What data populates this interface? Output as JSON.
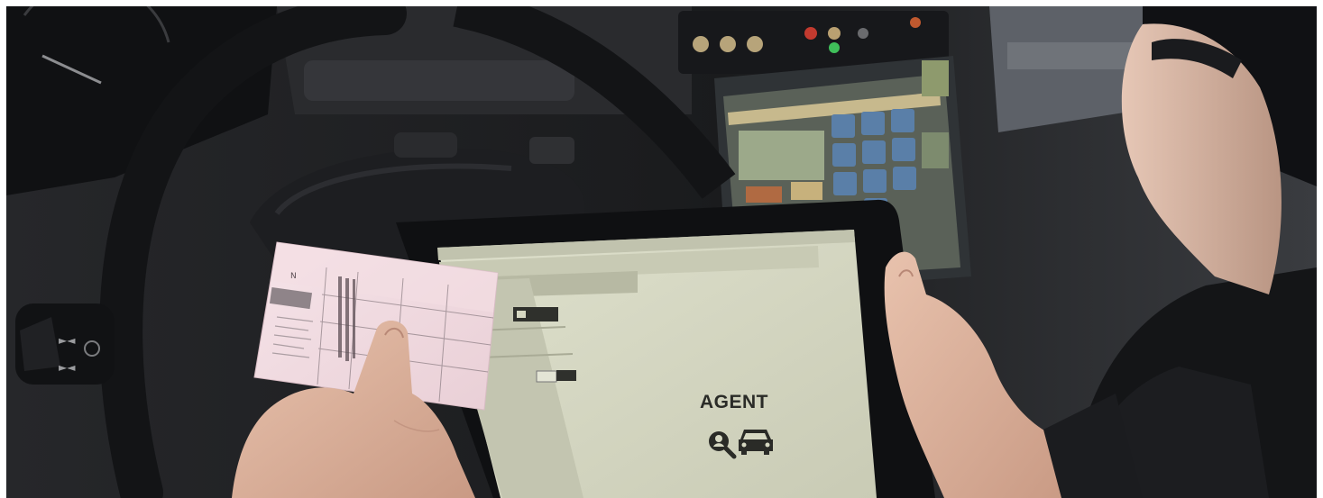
{
  "tablet": {
    "app_label": "AGENT",
    "icons": [
      "person-search-icon",
      "car-icon"
    ]
  },
  "colors": {
    "screen": "#d6d8c2",
    "license_card": "#f0d9df",
    "dashboard": "#1e1f22",
    "steering_wheel": "#16171a"
  }
}
